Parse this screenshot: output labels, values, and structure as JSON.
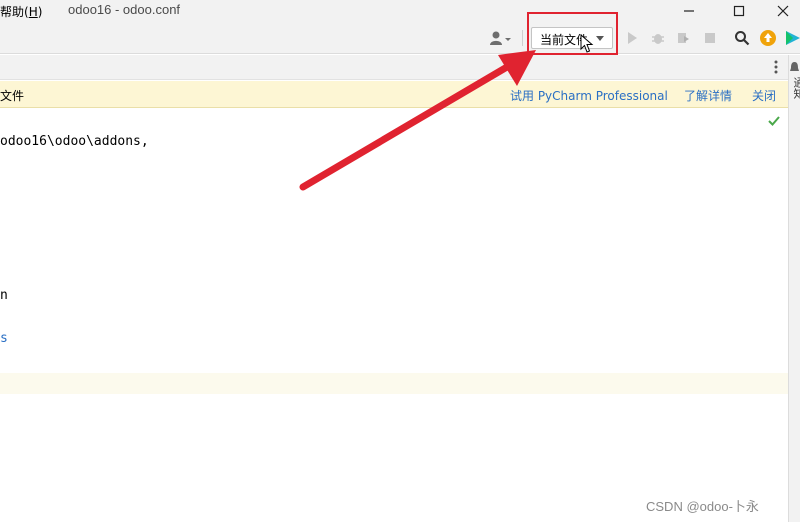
{
  "titlebar": {
    "menu_help_prefix": "帮助(",
    "menu_help_key": "H",
    "menu_help_suffix": ")",
    "window_title": "odoo16 - odoo.conf"
  },
  "toolbar": {
    "run_config_label": "当前文件",
    "icons": [
      "user-icon",
      "run-icon",
      "debug-icon",
      "coverage-icon",
      "stop-icon",
      "search-icon",
      "update-icon",
      "toolbox-icon"
    ]
  },
  "banner": {
    "text": "文件",
    "try_link": "试用 PyCharm Professional",
    "learn_more_link": "了解详情",
    "close_link": "关闭"
  },
  "editor": {
    "lines": [
      "odoo16\\odoo\\addons,",
      "n",
      "s"
    ]
  },
  "side_panel": {
    "label": "通知"
  },
  "watermark": "CSDN @odoo-卜永",
  "colors": {
    "highlight": "#e02330",
    "link": "#2a6fc4",
    "banner_bg": "#fdf6d4"
  }
}
